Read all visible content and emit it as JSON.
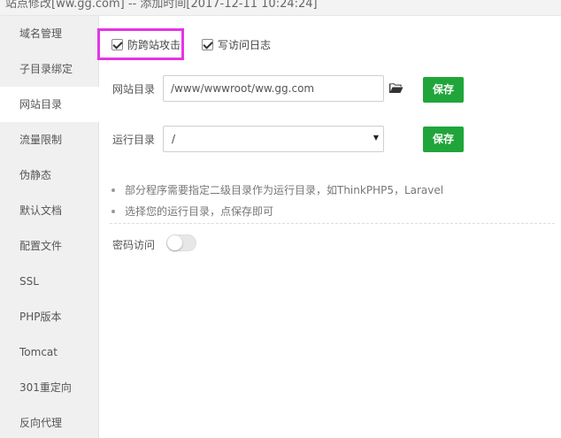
{
  "window": {
    "title": "站点修改[ww.gg.com] -- 添加时间[2017-12-11 10:24:24]"
  },
  "sidebar": {
    "items": [
      {
        "label": "域名管理"
      },
      {
        "label": "子目录绑定"
      },
      {
        "label": "网站目录",
        "active": true
      },
      {
        "label": "流量限制"
      },
      {
        "label": "伪静态"
      },
      {
        "label": "默认文档"
      },
      {
        "label": "配置文件"
      },
      {
        "label": "SSL"
      },
      {
        "label": "PHP版本"
      },
      {
        "label": "Tomcat"
      },
      {
        "label": "301重定向"
      },
      {
        "label": "反向代理"
      }
    ]
  },
  "main": {
    "options": {
      "anti_xss_label": "防跨站攻击",
      "anti_xss_checked": true,
      "access_log_label": "写访问日志",
      "access_log_checked": true
    },
    "site_dir": {
      "label": "网站目录",
      "value": "/www/wwwroot/ww.gg.com",
      "save_label": "保存"
    },
    "run_dir": {
      "label": "运行目录",
      "selected": "/",
      "save_label": "保存"
    },
    "tips": [
      "部分程序需要指定二级目录作为运行目录，如ThinkPHP5，Laravel",
      "选择您的运行目录，点保存即可"
    ],
    "password_access": {
      "label": "密码访问",
      "enabled": false
    }
  },
  "colors": {
    "accent": "#20a53a",
    "highlight": "#e534e5",
    "sidebar_bg": "#f0f0f0"
  },
  "icons": {
    "browse": "folder-open-icon",
    "dropdown": "triangle-down-icon"
  }
}
